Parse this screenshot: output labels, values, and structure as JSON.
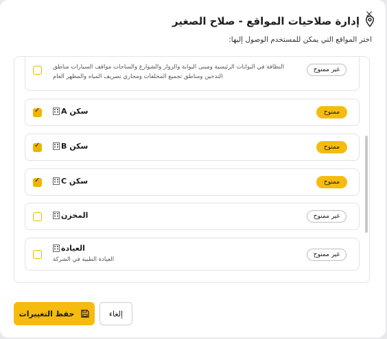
{
  "modal": {
    "title": "إدارة صلاحيات المواقع - صلاح الصغير",
    "subtitle": "اختر المواقع التي يمكن للمستخدم الوصول إليها:",
    "close_icon": "×"
  },
  "colors": {
    "accent": "#f5bb0e",
    "border": "#e2e2e2"
  },
  "locations": [
    {
      "desc_line1": "النظافة في البوابات الرئيسية ومبنى البوابة والزوار والشوارع والساحات مواقف السيارات مناطق",
      "desc_line2": "التدخين ومناطق تجميع المخلفات ومجاري تصريف المياه والمظهر العام",
      "status": "غير ممنوح",
      "checked": false
    },
    {
      "name": "سكن A",
      "icon": "building-icon",
      "status": "ممنوح",
      "checked": true
    },
    {
      "name": "سكن B",
      "icon": "building-icon",
      "status": "ممنوح",
      "checked": true
    },
    {
      "name": "سكن C",
      "icon": "building-icon",
      "status": "ممنوح",
      "checked": true
    },
    {
      "name": "المخزن",
      "icon": "building-icon",
      "status": "غير ممنوح",
      "checked": false
    },
    {
      "name": "العيادة",
      "desc_line1": "العيادة الطبية في الشركة",
      "icon": "building-icon",
      "status": "غير ممنوح",
      "checked": false
    }
  ],
  "footer": {
    "save_label": "حفظ التغييرات",
    "save_icon": "floppy-disk-icon",
    "cancel_label": "إلغاء"
  }
}
